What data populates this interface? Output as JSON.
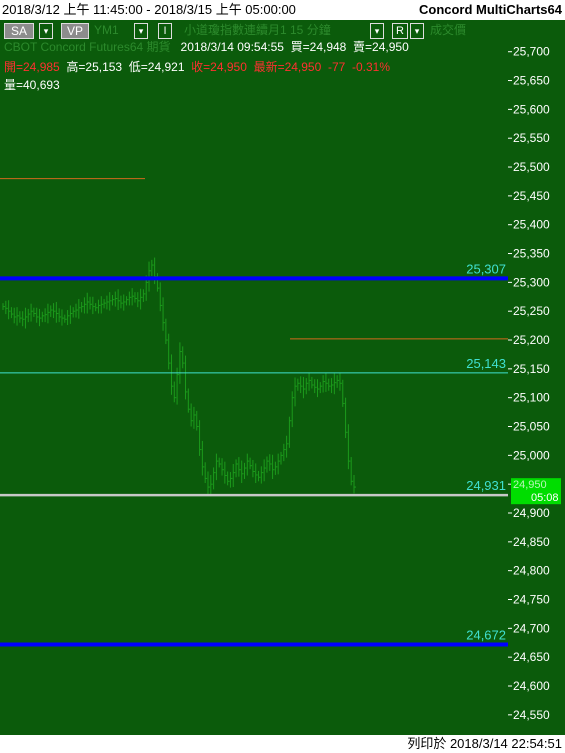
{
  "title": {
    "range": "2018/3/12 上午 11:45:00 - 2018/3/15 上午 05:00:00",
    "app_name": "Concord MultiCharts64"
  },
  "toolbar": {
    "sa_label": "SA",
    "sa_dropdown": "▾",
    "vp_label": "VP",
    "symbol": "YM1",
    "symbol_dropdown": "▾",
    "indicator_label": "I",
    "indicator_dropdown": "▾",
    "instrument_desc": "小道瓊指數連續月1 15 分鐘",
    "menu_dropdown": "▾",
    "r_label": "R",
    "r_dropdown": "▾",
    "volume_label": "成交價"
  },
  "info": {
    "exchange": "CBOT  Concord Futures64  期貨",
    "datetime": "2018/3/14  09:54:55",
    "bid": "買=24,948",
    "ask": "賣=24,950",
    "open": "開=24,985",
    "high": "高=25,153",
    "low": "低=24,921",
    "close": "收=24,950",
    "last": "最新=24,950",
    "change": "-77",
    "change_pct": "-0.31%",
    "volume": "量=40,693"
  },
  "footer": {
    "printed_at": "列印於 2018/3/14 22:54:51"
  },
  "colors": {
    "background": "#0b5b0b",
    "bars": "#1c9a1c",
    "axis_text": "#ffffff",
    "blue_line": "#0000ff",
    "cyan_line": "#40e0d0",
    "gray_line": "#c8c8c8",
    "orange_line": "#d2691e",
    "last_marker": "#00dd00"
  },
  "chart_data": {
    "type": "bar",
    "ylim": [
      24515,
      25755
    ],
    "y_ticks": [
      "25,700",
      "25,650",
      "25,600",
      "25,550",
      "25,500",
      "25,450",
      "25,400",
      "25,350",
      "25,300",
      "25,250",
      "25,200",
      "25,150",
      "25,100",
      "25,050",
      "25,000",
      "24,950",
      "24,900",
      "24,850",
      "24,800",
      "24,750",
      "24,700",
      "24,650",
      "24,600",
      "24,550"
    ],
    "horizontal_lines": [
      {
        "value": 25307,
        "label": "25,307",
        "color": "#0000ff",
        "style": "thick"
      },
      {
        "value": 25143,
        "label": "25,143",
        "color": "#40e0d0",
        "style": "thin"
      },
      {
        "value": 24931,
        "label": "24,931",
        "color": "#c8c8c8",
        "style": "medium"
      },
      {
        "value": 24672,
        "label": "24,672",
        "color": "#0000ff",
        "style": "thick"
      }
    ],
    "orange_levels": [
      25480,
      25202
    ],
    "last_price_labels": [
      "24,950",
      "05:08"
    ],
    "series": [
      {
        "values": [
          25258,
          25255,
          25250,
          25245,
          25240,
          25242,
          25238,
          25236,
          25240,
          25245,
          25250,
          25246,
          25240,
          25238,
          25242,
          25244,
          25248,
          25252,
          25250,
          25246,
          25240,
          25238,
          25236,
          25242,
          25246,
          25250,
          25252,
          25256,
          25258,
          25262,
          25266,
          25262,
          25258,
          25256,
          25260,
          25262,
          25264,
          25266,
          25268,
          25270,
          25272,
          25268,
          25264,
          25266,
          25270,
          25274,
          25276,
          25272,
          25268,
          25274,
          25280,
          25300,
          25320,
          25330,
          25310,
          25290,
          25260,
          25230,
          25200,
          25160,
          25120,
          25100,
          25140,
          25180,
          25160,
          25110,
          25080,
          25060,
          25070,
          25050,
          25010,
          24980,
          24960,
          24945,
          24950,
          24970,
          24990,
          24985,
          24975,
          24965,
          24955,
          24960,
          24970,
          24985,
          24975,
          24968,
          24978,
          24990,
          24982,
          24972,
          24966,
          24962,
          24970,
          24978,
          24990,
          24985,
          24975,
          24980,
          24990,
          25000,
          25010,
          25020,
          25060,
          25100,
          25120,
          25125,
          25120,
          25115,
          25125,
          25130,
          25122,
          25118,
          25115,
          25120,
          25128,
          25125,
          25120,
          25122,
          25126,
          25130,
          25125,
          25090,
          25040,
          24990,
          24955,
          24945
        ]
      }
    ]
  }
}
